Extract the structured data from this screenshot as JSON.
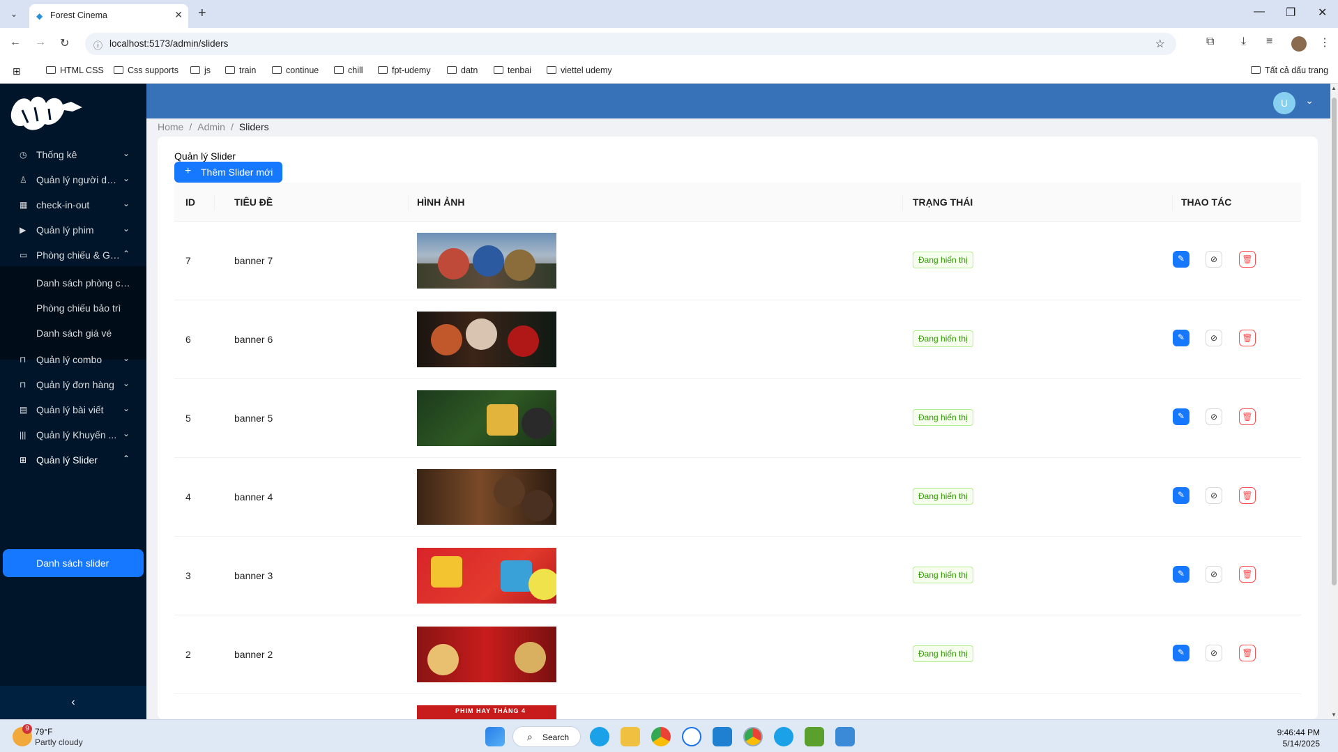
{
  "browser": {
    "tab_title": "Forest Cinema",
    "url": "localhost:5173/admin/sliders",
    "bookmarks": [
      "HTML CSS",
      "Css supports",
      "js",
      "train",
      "continue",
      "chill",
      "fpt-udemy",
      "datn",
      "tenbai",
      "viettel udemy"
    ],
    "all_bookmarks_label": "Tất cả dấu trang"
  },
  "sidebar": {
    "items": [
      {
        "label": "Thống kê",
        "icon": "dashboard-icon"
      },
      {
        "label": "Quản lý người dù...",
        "icon": "user-icon"
      },
      {
        "label": "check-in-out",
        "icon": "calendar-icon"
      },
      {
        "label": "Quản lý phim",
        "icon": "film-icon"
      },
      {
        "label": "Phòng chiếu & Gi...",
        "icon": "desktop-icon"
      },
      {
        "label": "Quản lý combo",
        "icon": "bag-icon"
      },
      {
        "label": "Quản lý đơn hàng",
        "icon": "bag-icon"
      },
      {
        "label": "Quản lý bài viết",
        "icon": "file-icon"
      },
      {
        "label": "Quản lý Khuyến ...",
        "icon": "barcode-icon"
      },
      {
        "label": "Quản lý Slider",
        "icon": "appstore-icon"
      }
    ],
    "submenu_rooms": [
      "Danh sách phòng ch...",
      "Phòng chiếu bảo trì",
      "Danh sách giá vé"
    ],
    "submenu_slider_active": "Danh sách slider"
  },
  "header": {
    "avatar_initial": "U"
  },
  "breadcrumb": {
    "home": "Home",
    "admin": "Admin",
    "current": "Sliders"
  },
  "page": {
    "heading": "Quản lý Slider",
    "add_button": "Thêm Slider mới"
  },
  "table": {
    "columns": [
      "ID",
      "TIÊU ĐỀ",
      "HÌNH ẢNH",
      "TRẠNG THÁI",
      "THAO TÁC"
    ],
    "rows": [
      {
        "id": "7",
        "title": "banner 7",
        "status": "Đang hiển thị"
      },
      {
        "id": "6",
        "title": "banner 6",
        "status": "Đang hiển thị"
      },
      {
        "id": "5",
        "title": "banner 5",
        "status": "Đang hiển thị"
      },
      {
        "id": "4",
        "title": "banner 4",
        "status": "Đang hiển thị"
      },
      {
        "id": "3",
        "title": "banner 3",
        "status": "Đang hiển thị"
      },
      {
        "id": "2",
        "title": "banner 2",
        "status": "Đang hiển thị"
      }
    ],
    "partial_thumb_text": "PHIM HAY THÁNG 4"
  },
  "taskbar": {
    "weather_temp": "79°F",
    "weather_desc": "Partly cloudy",
    "weather_badge": "9",
    "search_label": "Search",
    "time": "9:46:44 PM",
    "date": "5/14/2025"
  },
  "colors": {
    "primary": "#1677ff",
    "header": "#3772b8",
    "sidebar": "#001529",
    "success": "#389e0d"
  }
}
